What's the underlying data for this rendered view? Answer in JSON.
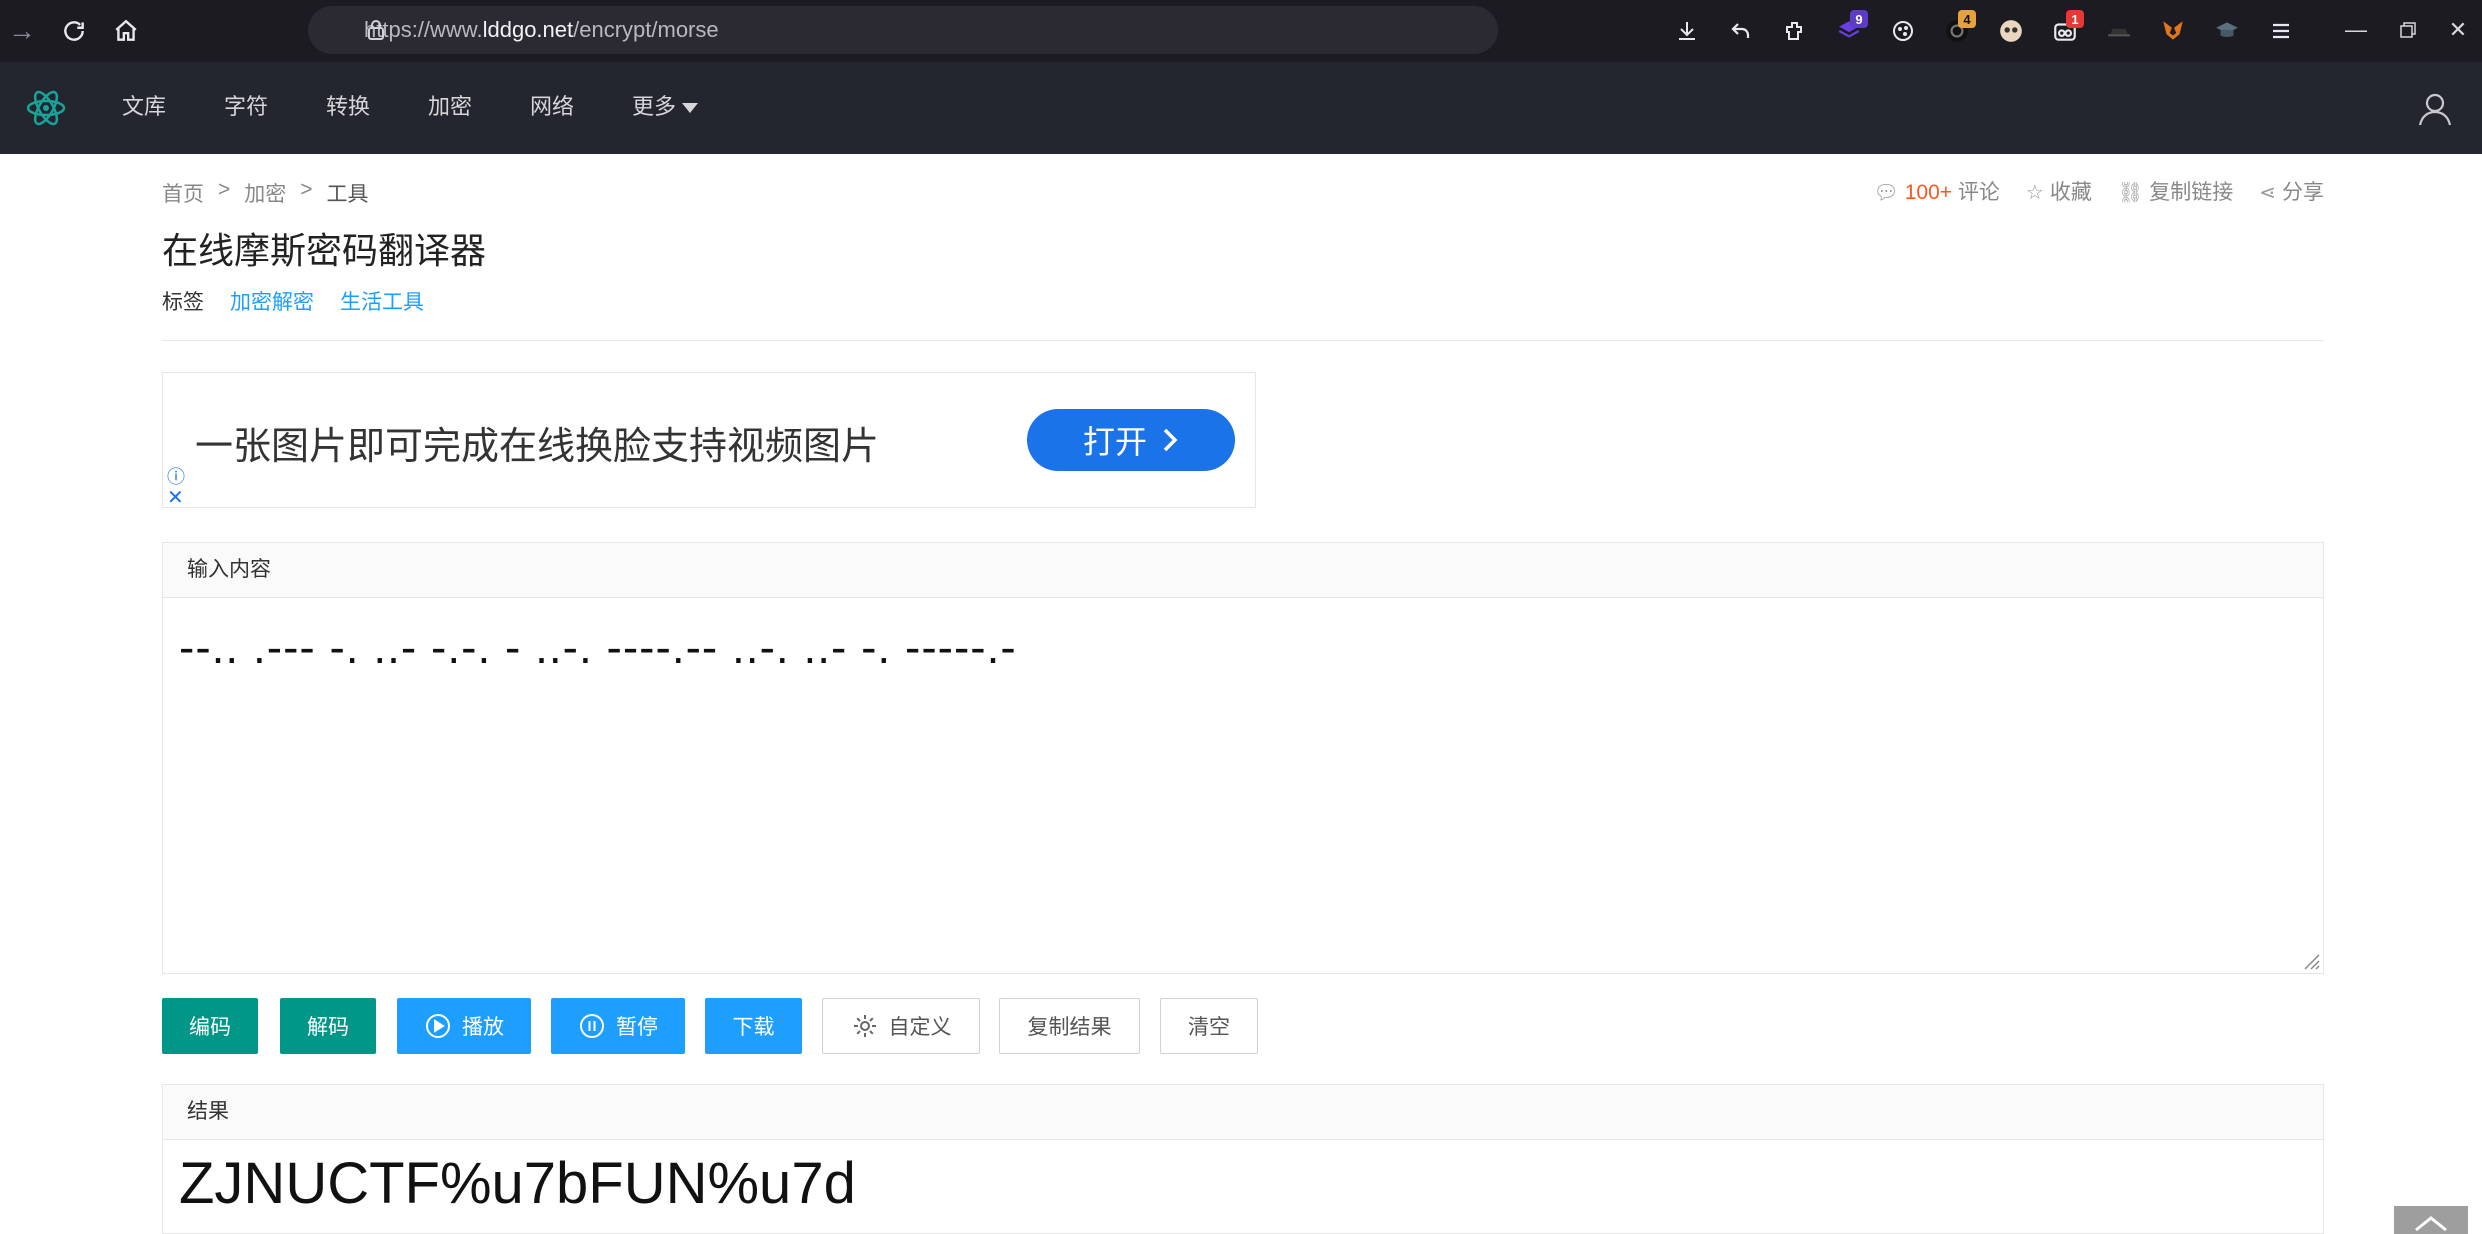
{
  "browser": {
    "url_prefix": "https://www.",
    "url_host": "lddgo.net",
    "url_path": "/encrypt/morse",
    "badges": {
      "ext1": "9",
      "ext2": "4",
      "ext3": "1"
    }
  },
  "site_nav": {
    "items": [
      "文库",
      "字符",
      "转换",
      "加密",
      "网络"
    ],
    "more": "更多"
  },
  "breadcrumb": {
    "home": "首页",
    "sep": ">",
    "category": "加密",
    "current": "工具"
  },
  "actions": {
    "comment_count": "100+",
    "comment": "评论",
    "favorite": "收藏",
    "copy_link": "复制链接",
    "share": "分享"
  },
  "page": {
    "title": "在线摩斯密码翻译器",
    "tags_label": "标签",
    "tags": [
      "加密解密",
      "生活工具"
    ]
  },
  "ad": {
    "text": "一张图片即可完成在线换脸支持视频图片",
    "button": "打开"
  },
  "input": {
    "label": "输入内容",
    "value": "--.. .--- -. ..- -.-. - ..-. ----.-- ..-. ..- -. -----.-"
  },
  "buttons": {
    "encode": "编码",
    "decode": "解码",
    "play": "播放",
    "pause": "暂停",
    "download": "下载",
    "custom": "自定义",
    "copy_result": "复制结果",
    "clear": "清空"
  },
  "result": {
    "label": "结果",
    "value": "ZJNUCTF%u7bFUN%u7d"
  },
  "colors": {
    "teal": "#009688",
    "blue": "#1e9fff",
    "nav_bg": "#23262e",
    "browser_bg": "#1c1b22",
    "accent_orange": "#ff5722"
  }
}
